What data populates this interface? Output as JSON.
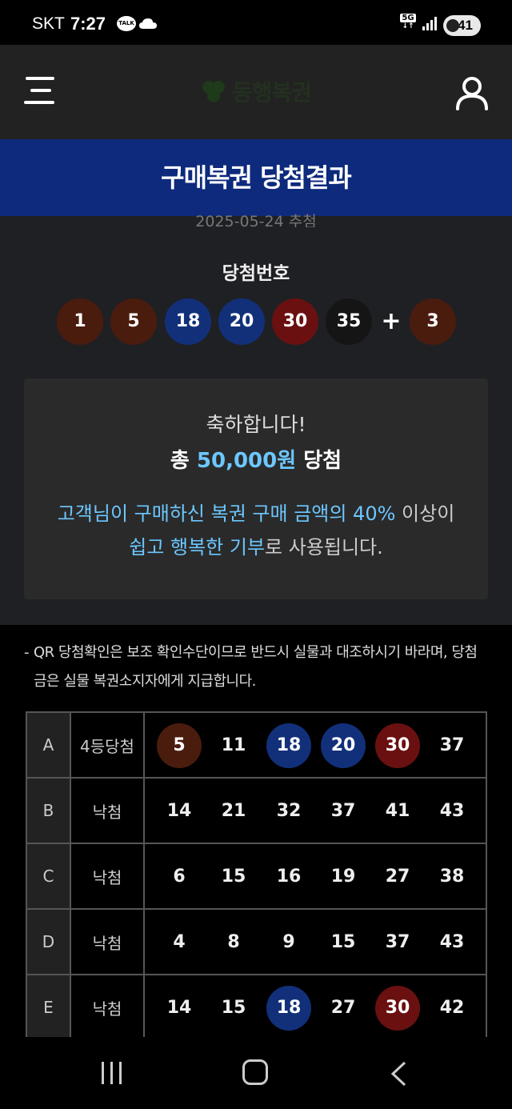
{
  "status_bar": {
    "carrier": "SKT",
    "time": "7:27",
    "talk_label": "TALK",
    "network": "5G",
    "battery": "41"
  },
  "header": {
    "logo_text": "동행복권"
  },
  "banner": {
    "title": "구매복권 당첨결과"
  },
  "draw": {
    "date_text": "2025-05-24 추첨",
    "winning_title": "당첨번호",
    "winning_numbers": [
      "1",
      "5",
      "18",
      "20",
      "30",
      "35"
    ],
    "bonus_number": "3",
    "plus_symbol": "+"
  },
  "result_box": {
    "congrats": "축하합니다!",
    "prize_prefix": "총 ",
    "prize_amount": "50,000원",
    "prize_suffix": " 당첨",
    "donation_part1": "고객님이 구매하신 복권 구매 금액의 40%",
    "donation_part2": " 이상이",
    "donation_part3": "쉽고 행복한 기부",
    "donation_part4": "로 사용됩니다."
  },
  "notice": {
    "dash": "-",
    "text": "QR 당첨확인은 보조 확인수단이므로 반드시 실물과 대조하시기 바라며, 당첨금은 실물 복권소지자에게 지급합니다."
  },
  "ticket": {
    "rows": [
      {
        "game": "A",
        "result": "4등당첨",
        "numbers": [
          "5",
          "11",
          "18",
          "20",
          "30",
          "37"
        ],
        "matched": [
          true,
          false,
          true,
          true,
          true,
          false
        ]
      },
      {
        "game": "B",
        "result": "낙첨",
        "numbers": [
          "14",
          "21",
          "32",
          "37",
          "41",
          "43"
        ],
        "matched": [
          false,
          false,
          false,
          false,
          false,
          false
        ]
      },
      {
        "game": "C",
        "result": "낙첨",
        "numbers": [
          "6",
          "15",
          "16",
          "19",
          "27",
          "38"
        ],
        "matched": [
          false,
          false,
          false,
          false,
          false,
          false
        ]
      },
      {
        "game": "D",
        "result": "낙첨",
        "numbers": [
          "4",
          "8",
          "9",
          "15",
          "37",
          "43"
        ],
        "matched": [
          false,
          false,
          false,
          false,
          false,
          false
        ]
      },
      {
        "game": "E",
        "result": "낙첨",
        "numbers": [
          "14",
          "15",
          "18",
          "27",
          "30",
          "42"
        ],
        "matched": [
          false,
          false,
          true,
          false,
          true,
          false
        ]
      }
    ]
  },
  "colors": {
    "banner": "#0d2a7c",
    "highlight": "#6cc7ff",
    "ball_1_10": "#4a1c0e",
    "ball_11_20": "#12307a",
    "ball_21_30": "#6a1010",
    "ball_31_40": "#151515",
    "ball_41_45": "#1f5a20"
  }
}
